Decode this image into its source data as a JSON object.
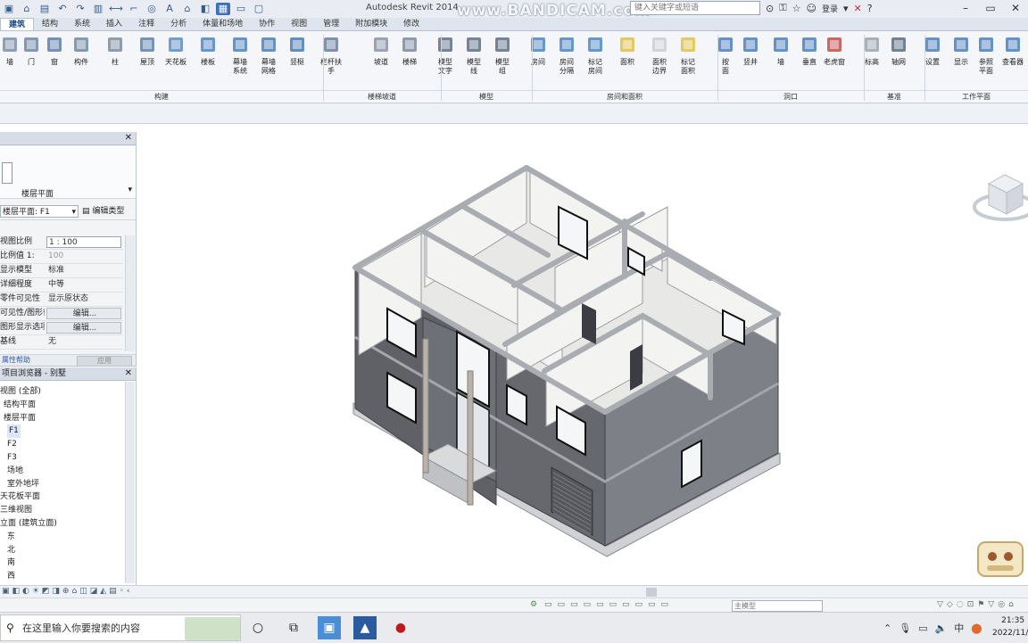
{
  "titlebar": {
    "app_title": "Autodesk Revit 2014",
    "watermark": "www.BANDICAM.com",
    "search_placeholder": "键入关键字或短语",
    "login": "登录"
  },
  "tabs": [
    {
      "label": "建筑",
      "active": true
    },
    {
      "label": "结构"
    },
    {
      "label": "系统"
    },
    {
      "label": "插入"
    },
    {
      "label": "注释"
    },
    {
      "label": "分析"
    },
    {
      "label": "体量和场地"
    },
    {
      "label": "协作"
    },
    {
      "label": "视图"
    },
    {
      "label": "管理"
    },
    {
      "label": "附加模块"
    },
    {
      "label": "修改"
    }
  ],
  "ribbon": {
    "buttons": [
      {
        "label": "墙",
        "icon": "wall-icon",
        "color": "#7a8fa8"
      },
      {
        "label": "门",
        "icon": "door-icon",
        "color": "#6f87a6"
      },
      {
        "label": "窗",
        "icon": "window-icon",
        "color": "#5d7ea8"
      },
      {
        "label": "构件",
        "icon": "component-icon",
        "color": "#708aa4"
      },
      {
        "label": "柱",
        "icon": "column-icon",
        "color": "#7b8ca0"
      },
      {
        "label": "屋顶",
        "icon": "roof-icon",
        "color": "#5f82ad"
      },
      {
        "label": "天花板",
        "icon": "ceiling-icon",
        "color": "#5b8fc2"
      },
      {
        "label": "楼板",
        "icon": "floor-icon",
        "color": "#4f86c6"
      },
      {
        "label": "幕墙\n系统",
        "icon": "curtain-system-icon",
        "color": "#4e83bf"
      },
      {
        "label": "幕墙\n网格",
        "icon": "curtain-grid-icon",
        "color": "#4c7fb9"
      },
      {
        "label": "竖梃",
        "icon": "mullion-icon",
        "color": "#4a7bb4"
      },
      {
        "label": "栏杆扶手",
        "icon": "railing-icon",
        "color": "#6b7fa0"
      },
      {
        "label": "坡道",
        "icon": "ramp-icon",
        "color": "#8a94a6"
      },
      {
        "label": "楼梯",
        "icon": "stair-icon",
        "color": "#7d8aa0"
      },
      {
        "label": "模型\n文字",
        "icon": "model-text-icon",
        "color": "#5f6f86"
      },
      {
        "label": "模型\n线",
        "icon": "model-line-icon",
        "color": "#5f6f86"
      },
      {
        "label": "模型\n组",
        "icon": "model-group-icon",
        "color": "#5f6f86"
      },
      {
        "label": "房间",
        "icon": "room-icon",
        "color": "#4d86c3"
      },
      {
        "label": "房间\n分隔",
        "icon": "room-separator-icon",
        "color": "#4d86c3"
      },
      {
        "label": "标记\n房间",
        "icon": "tag-room-icon",
        "color": "#4d86c3"
      },
      {
        "label": "面积",
        "icon": "area-icon",
        "color": "#e0c04a"
      },
      {
        "label": "面积\n边界",
        "icon": "area-boundary-icon",
        "color": "#c9ccd2"
      },
      {
        "label": "标记\n面积",
        "icon": "tag-area-icon",
        "color": "#e0c04a"
      },
      {
        "label": "按\n面",
        "icon": "by-face-icon",
        "color": "#4e80bd"
      },
      {
        "label": "竖井",
        "icon": "shaft-icon",
        "color": "#4e80bd"
      },
      {
        "label": "墙",
        "icon": "wall-opening-icon",
        "color": "#4e80bd"
      },
      {
        "label": "垂直",
        "icon": "vertical-opening-icon",
        "color": "#4e80bd"
      },
      {
        "label": "老虎窗",
        "icon": "dormer-icon",
        "color": "#c0504d"
      },
      {
        "label": "标高",
        "icon": "level-icon",
        "color": "#9aa3ae"
      },
      {
        "label": "轴网",
        "icon": "grid-icon",
        "color": "#5b6c82"
      },
      {
        "label": "设置",
        "icon": "set-icon",
        "color": "#4e80bd"
      },
      {
        "label": "显示",
        "icon": "show-icon",
        "color": "#4e80bd"
      },
      {
        "label": "参照\n平面",
        "icon": "ref-plane-icon",
        "color": "#4e80bd"
      },
      {
        "label": "查看器",
        "icon": "viewer-icon",
        "color": "#4e80bd"
      }
    ],
    "groups": [
      {
        "label": "构建"
      },
      {
        "label": "楼梯坡道"
      },
      {
        "label": "模型"
      },
      {
        "label": "房间和面积"
      },
      {
        "label": "洞口"
      },
      {
        "label": "基准"
      },
      {
        "label": "工作平面"
      }
    ]
  },
  "properties": {
    "type_name": "楼层平面",
    "selector": "楼层平面: F1",
    "edit_type": "编辑类型",
    "rows": [
      {
        "key": "视图比例",
        "value": "1 : 100",
        "style": "box"
      },
      {
        "key": "比例值 1:",
        "value": "100",
        "style": "dim"
      },
      {
        "key": "显示模型",
        "value": "标准",
        "style": ""
      },
      {
        "key": "详细程度",
        "value": "中等",
        "style": ""
      },
      {
        "key": "零件可见性",
        "value": "显示原状态",
        "style": ""
      },
      {
        "key": "可见性/图形替换",
        "value": "编辑...",
        "style": "btn"
      },
      {
        "key": "图形显示选项",
        "value": "编辑...",
        "style": "btn"
      },
      {
        "key": "基线",
        "value": "无",
        "style": ""
      }
    ],
    "help": "属性帮助",
    "apply": "应用"
  },
  "browser": {
    "title": "项目浏览器 - 别墅",
    "items": [
      {
        "label": "视图 (全部)"
      },
      {
        "label": "结构平面"
      },
      {
        "label": "楼层平面"
      },
      {
        "label": "F1"
      },
      {
        "label": "F2"
      },
      {
        "label": "F3"
      },
      {
        "label": "场地"
      },
      {
        "label": "室外地坪"
      },
      {
        "label": "天花板平面"
      },
      {
        "label": "三维视图"
      },
      {
        "label": "立面 (建筑立面)"
      },
      {
        "label": "东"
      },
      {
        "label": "北"
      },
      {
        "label": "南"
      },
      {
        "label": "西"
      }
    ]
  },
  "statusbar": {
    "model": "主模型"
  },
  "taskbar": {
    "search_text": "在这里输入你要搜索的内容",
    "ime": "中",
    "time": "21:35",
    "date": "2022/11/1"
  },
  "colors": {
    "wall_dark": "#5f6167",
    "wall_mid": "#7d8087",
    "wall_light": "#f3f3f1",
    "wall_cap": "#a9acb1",
    "ribbon_bg": "#f4f6f9",
    "selection": "#3b6fb6"
  }
}
